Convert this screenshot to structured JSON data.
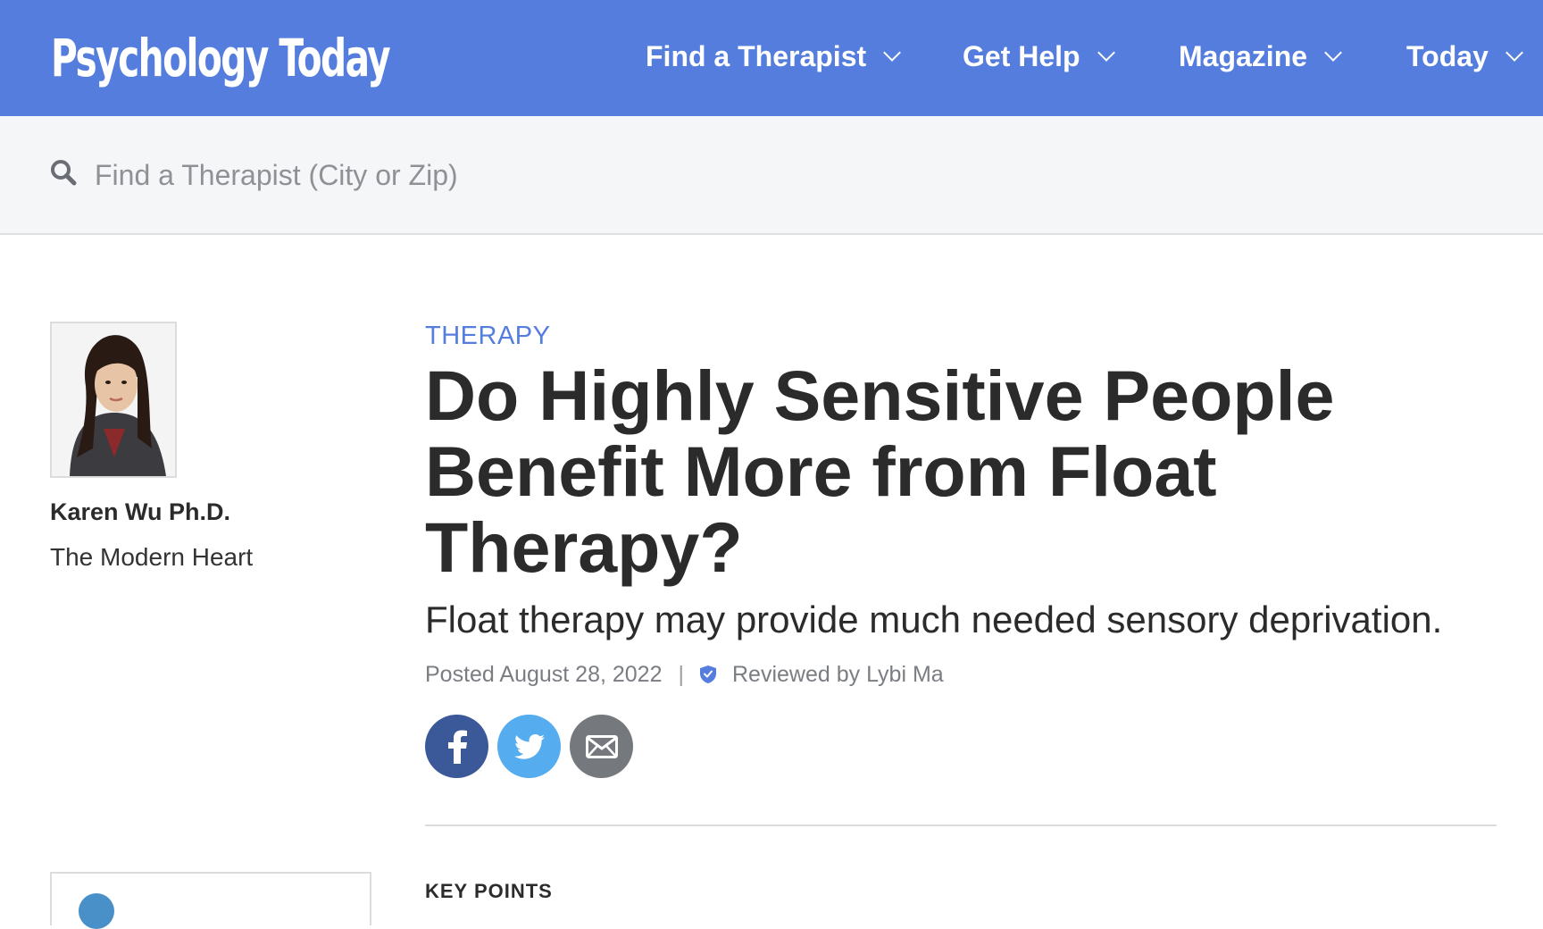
{
  "brand": {
    "name": "Psychology Today",
    "color": "#557dde"
  },
  "nav": {
    "items": [
      {
        "label": "Find a Therapist",
        "icon": "chevron-down-icon"
      },
      {
        "label": "Get Help",
        "icon": "chevron-down-icon"
      },
      {
        "label": "Magazine",
        "icon": "chevron-down-icon"
      },
      {
        "label": "Today",
        "icon": "chevron-down-icon"
      }
    ]
  },
  "search": {
    "icon": "search-icon",
    "placeholder": "Find a Therapist (City or Zip)",
    "value": ""
  },
  "author": {
    "name": "Karen Wu Ph.D.",
    "blog": "The Modern Heart",
    "photo_icon": "author-portrait"
  },
  "article": {
    "category": "THERAPY",
    "title": "Do Highly Sensitive People Benefit More from Float Therapy?",
    "subtitle": "Float therapy may provide much needed sensory deprivation.",
    "posted": "Posted August 28, 2022",
    "separator": "|",
    "reviewed": "Reviewed by Lybi Ma",
    "reviewed_icon": "verified-shield-icon",
    "key_points_heading": "KEY POINTS"
  },
  "share": {
    "buttons": [
      {
        "name": "facebook",
        "icon": "facebook-icon",
        "color": "#3b5998"
      },
      {
        "name": "twitter",
        "icon": "twitter-icon",
        "color": "#55acee"
      },
      {
        "name": "email",
        "icon": "email-icon",
        "color": "#75787d"
      }
    ]
  }
}
